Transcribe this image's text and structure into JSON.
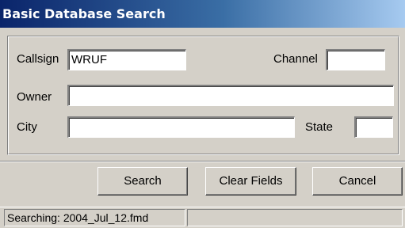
{
  "window": {
    "title": "Basic Database Search"
  },
  "form": {
    "callsign": {
      "label": "Callsign",
      "value": "WRUF"
    },
    "channel": {
      "label": "Channel",
      "value": ""
    },
    "owner": {
      "label": "Owner",
      "value": ""
    },
    "city": {
      "label": "City",
      "value": ""
    },
    "state": {
      "label": "State",
      "value": ""
    }
  },
  "buttons": {
    "search": "Search",
    "clear": "Clear Fields",
    "cancel": "Cancel"
  },
  "status": {
    "text": "Searching: 2004_Jul_12.fmd",
    "secondary": ""
  }
}
